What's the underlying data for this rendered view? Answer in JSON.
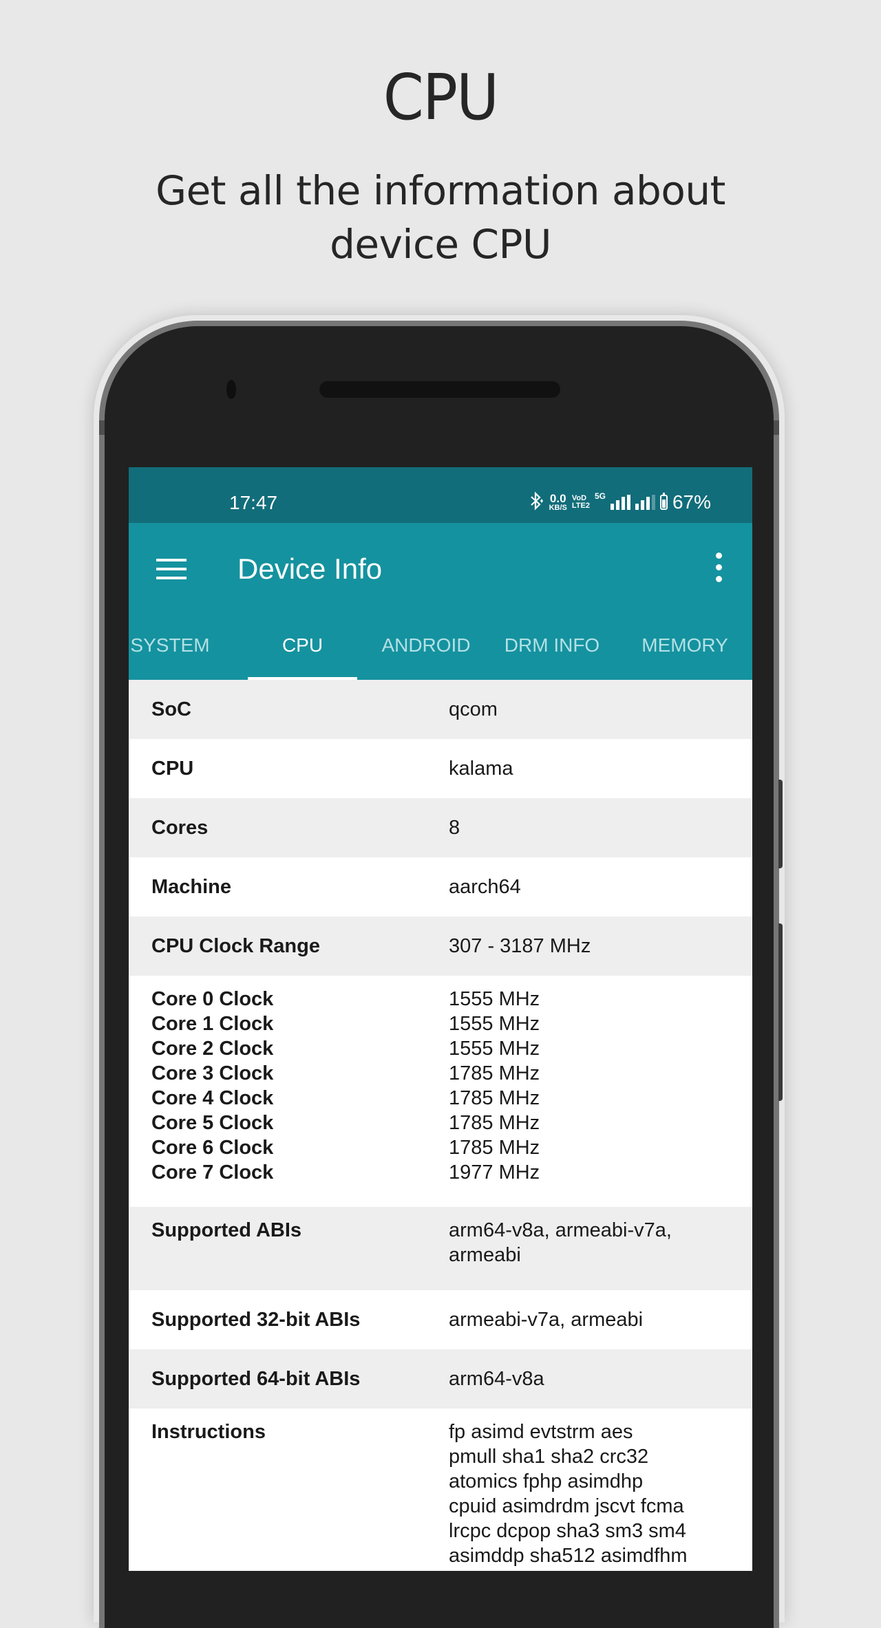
{
  "promo": {
    "title": "CPU",
    "subtitle_lines": [
      "Get all the information about",
      "device CPU"
    ]
  },
  "colors": {
    "background": "#e8e8e8",
    "statusbar": "#126d7a",
    "appbar": "#15929f",
    "tab_inactive": "#b3e0e5",
    "tab_active": "#ffffff",
    "row_alt": "#eeeeee"
  },
  "statusbar": {
    "time": "17:47",
    "icons": [
      "bluetooth-icon",
      "network-speed",
      "volte-icon",
      "5g-signal-icon",
      "signal-icon",
      "battery-icon"
    ],
    "net_speed_value": "0.0",
    "net_speed_unit": "KB/S",
    "volte_top": "VoD",
    "volte_bottom": "LTE2",
    "network_type": "5G",
    "battery_percent": "67%",
    "battery_level": 0.67
  },
  "appbar": {
    "title": "Device Info",
    "menu_icon": "hamburger-menu-icon",
    "overflow_icon": "more-vert-icon"
  },
  "tabs": [
    {
      "label": "SYSTEM",
      "active": false
    },
    {
      "label": "CPU",
      "active": true
    },
    {
      "label": "ANDROID",
      "active": false
    },
    {
      "label": "DRM INFO",
      "active": false
    },
    {
      "label": "MEMORY",
      "active": false
    }
  ],
  "rows": {
    "soc": {
      "key": "SoC",
      "value": "qcom"
    },
    "cpu": {
      "key": "CPU",
      "value": "kalama"
    },
    "cores": {
      "key": "Cores",
      "value": "8"
    },
    "machine": {
      "key": "Machine",
      "value": "aarch64"
    },
    "clock_range": {
      "key": "CPU Clock Range",
      "value": "307 - 3187 MHz"
    },
    "core_clocks": [
      {
        "key": "Core 0 Clock",
        "value": "1555 MHz"
      },
      {
        "key": "Core 1 Clock",
        "value": "1555 MHz"
      },
      {
        "key": "Core 2 Clock",
        "value": "1555 MHz"
      },
      {
        "key": "Core 3 Clock",
        "value": "1785 MHz"
      },
      {
        "key": "Core 4 Clock",
        "value": "1785 MHz"
      },
      {
        "key": "Core 5 Clock",
        "value": "1785 MHz"
      },
      {
        "key": "Core 6 Clock",
        "value": "1785 MHz"
      },
      {
        "key": "Core 7 Clock",
        "value": "1977 MHz"
      }
    ],
    "abis": {
      "key": "Supported ABIs",
      "value_lines": [
        "arm64-v8a, armeabi-v7a,",
        "armeabi"
      ]
    },
    "abis32": {
      "key": "Supported 32-bit ABIs",
      "value": "armeabi-v7a, armeabi"
    },
    "abis64": {
      "key": "Supported 64-bit ABIs",
      "value": "arm64-v8a"
    },
    "instructions": {
      "key": "Instructions",
      "value_lines": [
        "fp asimd evtstrm aes",
        "pmull sha1 sha2 crc32",
        "atomics fphp asimdhp",
        "cpuid asimdrdm jscvt fcma",
        "lrcpc dcpop sha3 sm3 sm4",
        "asimddp sha512 asimdfhm"
      ]
    }
  }
}
